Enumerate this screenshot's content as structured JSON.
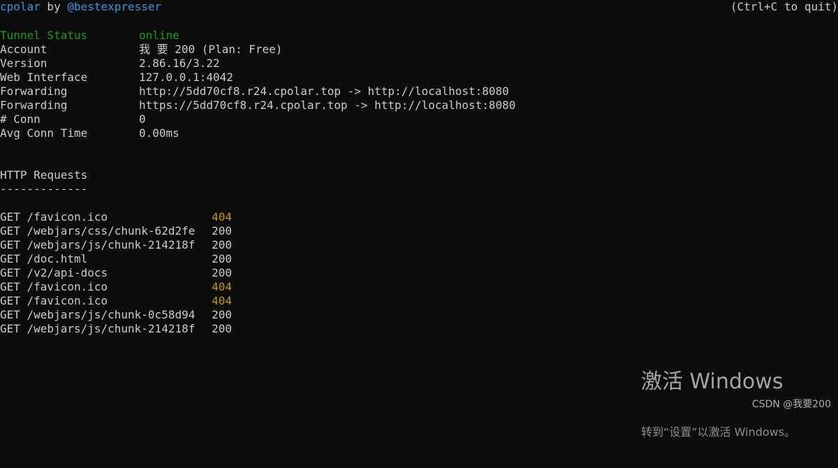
{
  "terminal": {
    "background_color": "#0c0c0c",
    "foreground_color": "#cccccc",
    "accent_blue": "#3a96dd",
    "accent_green": "#13a10e",
    "accent_yellow": "#c19c00"
  },
  "header": {
    "brand": "cpolar",
    "by": " by ",
    "handle": "@bestexpresser",
    "quit_hint": "(Ctrl+C to quit)"
  },
  "status": {
    "rows": [
      {
        "label": "Tunnel Status",
        "value": "online",
        "label_color": "green",
        "value_color": "green"
      },
      {
        "label": "Account",
        "value": "我 要 200 (Plan: Free)",
        "label_color": "default",
        "value_color": "default"
      },
      {
        "label": "Version",
        "value": "2.86.16/3.22",
        "label_color": "default",
        "value_color": "default"
      },
      {
        "label": "Web Interface",
        "value": "127.0.0.1:4042",
        "label_color": "default",
        "value_color": "default"
      },
      {
        "label": "Forwarding",
        "value": "http://5dd70cf8.r24.cpolar.top -> http://localhost:8080",
        "label_color": "default",
        "value_color": "default"
      },
      {
        "label": "Forwarding",
        "value": "https://5dd70cf8.r24.cpolar.top -> http://localhost:8080",
        "label_color": "default",
        "value_color": "default"
      },
      {
        "label": "# Conn",
        "value": "0",
        "label_color": "default",
        "value_color": "default"
      },
      {
        "label": "Avg Conn Time",
        "value": "0.00ms",
        "label_color": "default",
        "value_color": "default"
      }
    ]
  },
  "requests": {
    "title": "HTTP Requests",
    "rule": "-------------",
    "rows": [
      {
        "text": "GET /favicon.ico",
        "status": "404"
      },
      {
        "text": "GET /webjars/css/chunk-62d2fe",
        "status": "200"
      },
      {
        "text": "GET /webjars/js/chunk-214218f",
        "status": "200"
      },
      {
        "text": "GET /doc.html",
        "status": "200"
      },
      {
        "text": "GET /v2/api-docs",
        "status": "200"
      },
      {
        "text": "GET /favicon.ico",
        "status": "404"
      },
      {
        "text": "GET /favicon.ico",
        "status": "404"
      },
      {
        "text": "GET /webjars/js/chunk-0c58d94",
        "status": "200"
      },
      {
        "text": "GET /webjars/js/chunk-214218f",
        "status": "200"
      }
    ]
  },
  "activation_watermark": {
    "title": "激活 Windows",
    "subtitle": "转到“设置”以激活 Windows。"
  },
  "csdn_watermark": {
    "text": "CSDN @我要200"
  }
}
